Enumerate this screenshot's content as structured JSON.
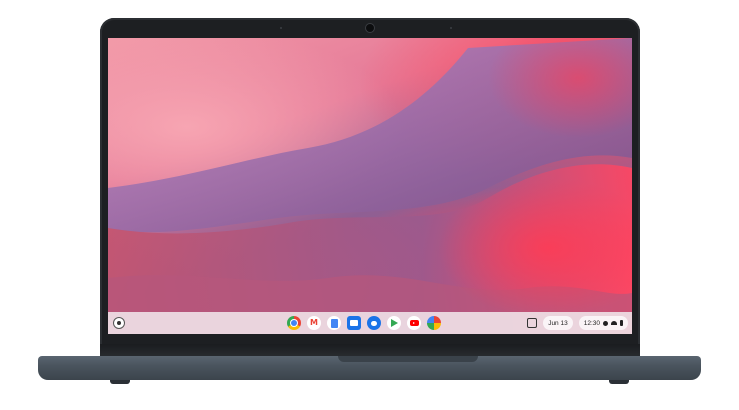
{
  "shelf": {
    "date": "Jun 13",
    "time": "12:30",
    "apps": [
      {
        "name": "chrome-icon",
        "color": "#4285f4"
      },
      {
        "name": "gmail-icon",
        "color": "#ea4335"
      },
      {
        "name": "docs-icon",
        "color": "#4285f4"
      },
      {
        "name": "files-icon",
        "color": "#1a73e8"
      },
      {
        "name": "messages-icon",
        "color": "#1a73e8"
      },
      {
        "name": "play-store-icon",
        "color": "#34a853"
      },
      {
        "name": "youtube-icon",
        "color": "#ff0000"
      },
      {
        "name": "photos-icon",
        "color": "#fbbc04"
      }
    ]
  },
  "colors": {
    "bezel": "#1d1f22",
    "base": "#4a545e",
    "wallpaper_red": "#ff4b5e",
    "wallpaper_purple": "#8f5f93",
    "wallpaper_pink": "#f29aa8"
  }
}
